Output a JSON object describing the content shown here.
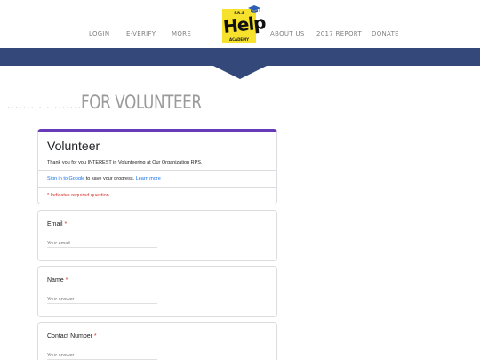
{
  "nav": {
    "left_items": [
      {
        "label": "LOGIN"
      },
      {
        "label": "E-VERIFY"
      },
      {
        "label": "MORE"
      }
    ],
    "right_items": [
      {
        "label": "ABOUT US"
      },
      {
        "label": "2017 REPORT"
      },
      {
        "label": "DONATE"
      }
    ],
    "logo": {
      "top_text": "P.R.S",
      "main_text": "Help",
      "bottom_text": "ACADEMY",
      "icon": "graduation-cap-icon"
    }
  },
  "colors": {
    "nav_band": "#34497a",
    "form_accent": "#673ab7",
    "logo_yellow": "#f6e12c",
    "link_blue": "#1a73e8",
    "required_red": "#d93025"
  },
  "page_title": {
    "dots": "...................",
    "text": "FOR VOLUNTEER"
  },
  "form": {
    "title": "Volunteer",
    "description": "Thank you for you INTEREST in Volunteering at Our Organization RPS.",
    "signin": {
      "link": "Sign in to Google",
      "rest": " to save your progress. ",
      "learn_more": "Learn more"
    },
    "required_note": "* Indicates required question",
    "questions": [
      {
        "label": "Email",
        "required_mark": "*",
        "placeholder": "Your email"
      },
      {
        "label": "Name",
        "required_mark": "*",
        "placeholder": "Your answer"
      },
      {
        "label": "Contact Number",
        "required_mark": "*",
        "placeholder": "Your answer"
      }
    ]
  }
}
